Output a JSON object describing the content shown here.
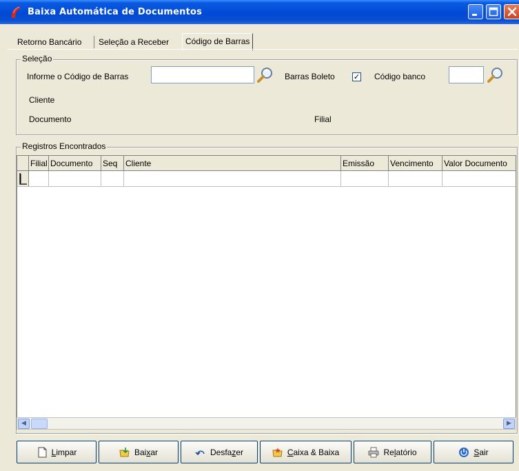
{
  "window": {
    "title": "Baixa Automática de Documentos"
  },
  "tabs": [
    {
      "label": "Retorno Bancário"
    },
    {
      "label": "Seleção a Receber"
    },
    {
      "label": "Código de Barras",
      "active": true
    }
  ],
  "selecao": {
    "group_title": "Seleção",
    "barcode_label": "Informe o Código de Barras",
    "barcode_value": "",
    "barras_boleto_label": "Barras Boleto",
    "barras_boleto_checked": true,
    "codigo_banco_label": "Código banco",
    "codigo_banco_value": "",
    "cliente_label": "Cliente",
    "documento_label": "Documento",
    "filial_label": "Filial"
  },
  "registros": {
    "group_title": "Registros Encontrados",
    "columns": [
      "Filial",
      "Documento",
      "Seq",
      "Cliente",
      "Emissão",
      "Vencimento",
      "Valor Documento"
    ]
  },
  "buttons": {
    "limpar_pre": "",
    "limpar_u": "L",
    "limpar_post": "impar",
    "baixar_pre": "Bai",
    "baixar_u": "x",
    "baixar_post": "ar",
    "desfazer_pre": "Desfa",
    "desfazer_u": "z",
    "desfazer_post": "er",
    "caixa_pre": "",
    "caixa_u": "C",
    "caixa_post": "aixa & Baixa",
    "relatorio_pre": "Re",
    "relatorio_u": "l",
    "relatorio_post": "atório",
    "sair_pre": "",
    "sair_u": "S",
    "sair_post": "air"
  },
  "colors": {
    "titlebar": "#0049d6",
    "window_bg": "#ece9d8"
  }
}
